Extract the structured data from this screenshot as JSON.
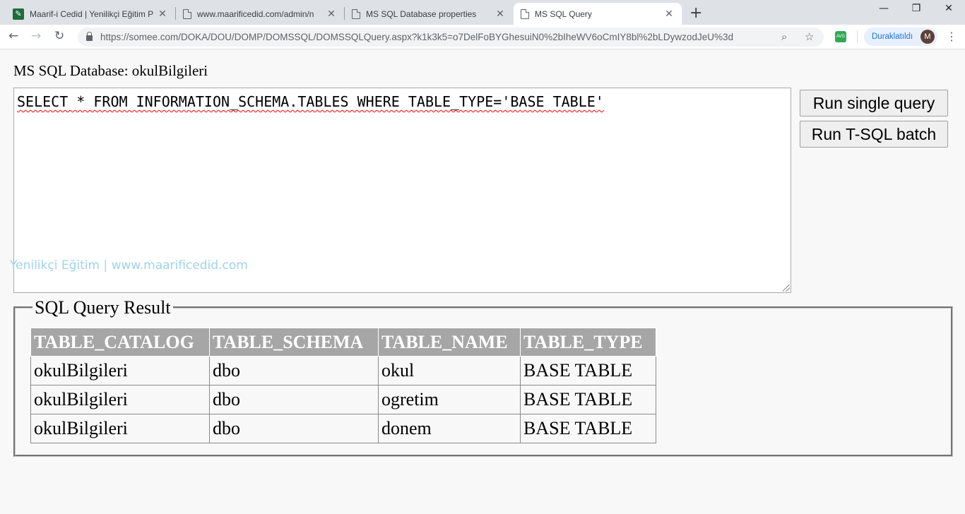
{
  "browser": {
    "tabs": [
      {
        "title": "Maarif-i Cedid | Yenilikçi Eğitim P",
        "icon": "leaf-icon",
        "active": false
      },
      {
        "title": "www.maarificedid.com/admin/n",
        "icon": "page-icon",
        "active": false
      },
      {
        "title": "MS SQL Database properties",
        "icon": "page-icon",
        "active": false
      },
      {
        "title": "MS SQL Query",
        "icon": "page-icon",
        "active": true
      }
    ],
    "close_glyph": "✕",
    "new_tab_glyph": "+",
    "window_controls": {
      "minimize": "—",
      "restore": "❐",
      "close": "✕"
    },
    "nav": {
      "back": "←",
      "forward": "→",
      "reload": "↻"
    },
    "url": "https://somee.com/DOKA/DOU/DOMP/DOMSSQL/DOMSSQLQuery.aspx?k1k3k5=o7DelFoBYGhesuiN0%2bIheWV6oCmIY8bl%2bLDywzodJeU%3d",
    "zoom_glyph": "⌕",
    "star_glyph": "☆",
    "extension_label": "AVG",
    "sync_status": "Duraklatıldı",
    "avatar_initial": "M",
    "menu_glyph": "⋮"
  },
  "page": {
    "db_title": "MS SQL Database: okulBilgileri",
    "query_text": "SELECT * FROM INFORMATION_SCHEMA.TABLES WHERE TABLE_TYPE='BASE TABLE'",
    "watermark": "Yenilikçi Eğitim | www.maarificedid.com",
    "buttons": {
      "run_single": "Run single query",
      "run_batch": "Run T-SQL batch"
    },
    "result": {
      "legend": "SQL Query Result",
      "columns": [
        "TABLE_CATALOG",
        "TABLE_SCHEMA",
        "TABLE_NAME",
        "TABLE_TYPE"
      ],
      "rows": [
        [
          "okulBilgileri",
          "dbo",
          "okul",
          "BASE TABLE"
        ],
        [
          "okulBilgileri",
          "dbo",
          "ogretim",
          "BASE TABLE"
        ],
        [
          "okulBilgileri",
          "dbo",
          "donem",
          "BASE TABLE"
        ]
      ]
    }
  }
}
